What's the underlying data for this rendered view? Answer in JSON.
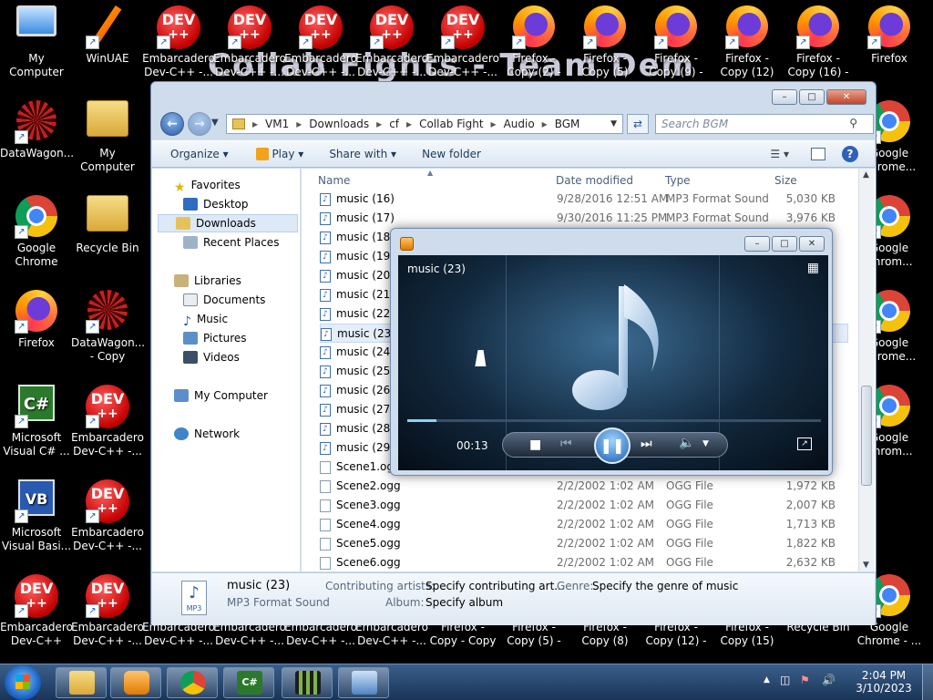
{
  "desktop": {
    "overlay_text": "Collab Fights - Team Dem",
    "icons": [
      {
        "label": "My Computer",
        "kind": "comp"
      },
      {
        "label": "WinUAE",
        "kind": "winuae"
      },
      {
        "label": "Embarcadero Dev-C++ -...",
        "kind": "dev"
      },
      {
        "label": "Embarcadero Dev-C++ -...",
        "kind": "dev"
      },
      {
        "label": "Embarcadero Dev-C++ -...",
        "kind": "dev"
      },
      {
        "label": "Embarcadero Dev-C++ -...",
        "kind": "dev"
      },
      {
        "label": "Embarcadero Dev-C++ -...",
        "kind": "dev"
      },
      {
        "label": "Firefox - Copy (2) - Copy",
        "kind": "fox"
      },
      {
        "label": "Firefox - Copy (5)",
        "kind": "fox"
      },
      {
        "label": "Firefox - Copy (9) - Copy",
        "kind": "fox"
      },
      {
        "label": "Firefox - Copy (12)",
        "kind": "fox"
      },
      {
        "label": "Firefox - Copy (16) - Copy",
        "kind": "fox"
      },
      {
        "label": "Firefox",
        "kind": "fox"
      },
      {
        "label": "DataWagon...",
        "kind": "dw"
      },
      {
        "label": "My Computer",
        "kind": "folder"
      },
      {
        "label": "Google Chrome",
        "kind": "chrome"
      },
      {
        "label": "Recycle Bin",
        "kind": "folder"
      },
      {
        "label": "Firefox",
        "kind": "fox"
      },
      {
        "label": "DataWagon... - Copy",
        "kind": "dw"
      },
      {
        "label": "Microsoft Visual C# ...",
        "kind": "cs"
      },
      {
        "label": "Embarcadero Dev-C++ -...",
        "kind": "dev"
      },
      {
        "label": "Microsoft Visual Basi...",
        "kind": "vb"
      },
      {
        "label": "Embarcadero Dev-C++ -...",
        "kind": "dev"
      },
      {
        "label": "Embarcadero Dev-C++",
        "kind": "dev"
      },
      {
        "label": "Embarcadero Dev-C++ -...",
        "kind": "dev"
      },
      {
        "label": "Embarcadero Dev-C++ -...",
        "kind": "dev"
      },
      {
        "label": "Embarcadero Dev-C++ -...",
        "kind": "dev"
      },
      {
        "label": "Embarcadero Dev-C++ -...",
        "kind": "dev"
      },
      {
        "label": "Embarcadero Dev-C++ -...",
        "kind": "dev"
      },
      {
        "label": "Firefox - Copy - Copy",
        "kind": "fox"
      },
      {
        "label": "Firefox - Copy (5) - Copy",
        "kind": "fox"
      },
      {
        "label": "Firefox - Copy (8)",
        "kind": "fox"
      },
      {
        "label": "Firefox - Copy (12) - Copy",
        "kind": "fox"
      },
      {
        "label": "Firefox - Copy (15)",
        "kind": "fox"
      },
      {
        "label": "Recycle Bin",
        "kind": "bin"
      },
      {
        "label": "Google Chrome - ...",
        "kind": "chrome"
      },
      {
        "label": "Google Chrome...",
        "kind": "chrome"
      },
      {
        "label": "Google Chrom...",
        "kind": "chrome"
      },
      {
        "label": "Google Chrome...",
        "kind": "chrome"
      },
      {
        "label": "Google Chrom...",
        "kind": "chrome"
      }
    ]
  },
  "explorer": {
    "breadcrumb": [
      "VM1",
      "Downloads",
      "cf",
      "Collab Fight",
      "Audio",
      "BGM"
    ],
    "search_placeholder": "Search BGM",
    "toolbar": {
      "organize": "Organize",
      "play": "Play",
      "share_with": "Share with",
      "new_folder": "New folder"
    },
    "nav": {
      "favorites": "Favorites",
      "desktop": "Desktop",
      "downloads": "Downloads",
      "recent": "Recent Places",
      "libraries": "Libraries",
      "documents": "Documents",
      "music": "Music",
      "pictures": "Pictures",
      "videos": "Videos",
      "computer": "My Computer",
      "network": "Network"
    },
    "columns": {
      "name": "Name",
      "date": "Date modified",
      "type": "Type",
      "size": "Size"
    },
    "files": [
      {
        "name": "music (16)",
        "date": "9/28/2016 12:51 AM",
        "type": "MP3 Format Sound",
        "size": "5,030 KB",
        "ext": "mp3"
      },
      {
        "name": "music (17)",
        "date": "9/30/2016 11:25 PM",
        "type": "MP3 Format Sound",
        "size": "3,976 KB",
        "ext": "mp3"
      },
      {
        "name": "music (18)",
        "date": "",
        "type": "",
        "size": "",
        "ext": "mp3"
      },
      {
        "name": "music (19)",
        "date": "",
        "type": "",
        "size": "",
        "ext": "mp3"
      },
      {
        "name": "music (20)",
        "date": "",
        "type": "",
        "size": "",
        "ext": "mp3"
      },
      {
        "name": "music (21)",
        "date": "",
        "type": "",
        "size": "",
        "ext": "mp3"
      },
      {
        "name": "music (22)",
        "date": "",
        "type": "",
        "size": "",
        "ext": "mp3"
      },
      {
        "name": "music (23)",
        "date": "",
        "type": "",
        "size": "",
        "ext": "mp3",
        "selected": true
      },
      {
        "name": "music (24)",
        "date": "",
        "type": "",
        "size": "",
        "ext": "mp3"
      },
      {
        "name": "music (25)",
        "date": "",
        "type": "",
        "size": "",
        "ext": "mp3"
      },
      {
        "name": "music (26)",
        "date": "",
        "type": "",
        "size": "",
        "ext": "mp3"
      },
      {
        "name": "music (27)",
        "date": "",
        "type": "",
        "size": "",
        "ext": "mp3"
      },
      {
        "name": "music (28)",
        "date": "",
        "type": "",
        "size": "",
        "ext": "mp3"
      },
      {
        "name": "music (29)",
        "date": "",
        "type": "",
        "size": "",
        "ext": "mp3"
      },
      {
        "name": "Scene1.ogg",
        "date": "",
        "type": "",
        "size": "",
        "ext": "ogg"
      },
      {
        "name": "Scene2.ogg",
        "date": "2/2/2002 1:02 AM",
        "type": "OGG File",
        "size": "1,972 KB",
        "ext": "ogg"
      },
      {
        "name": "Scene3.ogg",
        "date": "2/2/2002 1:02 AM",
        "type": "OGG File",
        "size": "2,007 KB",
        "ext": "ogg"
      },
      {
        "name": "Scene4.ogg",
        "date": "2/2/2002 1:02 AM",
        "type": "OGG File",
        "size": "1,713 KB",
        "ext": "ogg"
      },
      {
        "name": "Scene5.ogg",
        "date": "2/2/2002 1:02 AM",
        "type": "OGG File",
        "size": "1,822 KB",
        "ext": "ogg"
      },
      {
        "name": "Scene6.ogg",
        "date": "2/2/2002 1:02 AM",
        "type": "OGG File",
        "size": "2,632 KB",
        "ext": "ogg"
      }
    ],
    "details": {
      "title": "music (23)",
      "type": "MP3 Format Sound",
      "artists_label": "Contributing artists:",
      "artists_value": "Specify contributing art...",
      "genre_label": "Genre:",
      "genre_value": "Specify the genre of music",
      "album_label": "Album:",
      "album_value": "Specify album"
    }
  },
  "player": {
    "title": "music (23)",
    "time": "00:13",
    "progress": 0.07
  },
  "taskbar": {
    "time": "2:04 PM",
    "date": "3/10/2023"
  }
}
